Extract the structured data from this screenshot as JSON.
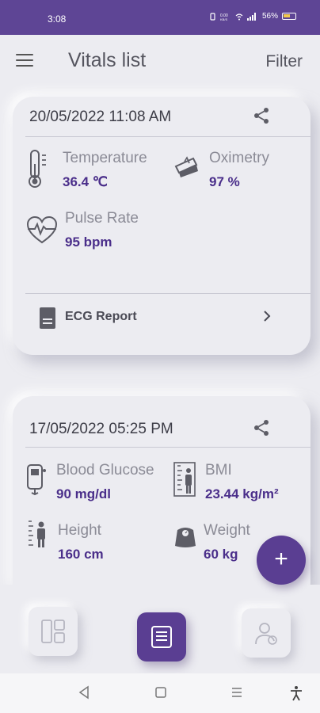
{
  "status_bar": {
    "time": "3:08",
    "battery": "56%",
    "indicators": [
      "vibrate-icon",
      "data-speed-icon",
      "wifi-icon",
      "signal-icon",
      "battery-icon"
    ]
  },
  "header": {
    "title": "Vitals list",
    "filter_label": "Filter",
    "menu_icon": "hamburger-icon"
  },
  "records": [
    {
      "date": "20/05/2022 11:08 AM",
      "vitals": [
        {
          "label": "Temperature",
          "value": "36.4 ℃",
          "icon": "thermometer-icon"
        },
        {
          "label": "Oximetry",
          "value": "97 %",
          "icon": "oximeter-icon"
        },
        {
          "label": "Pulse Rate",
          "value": "95 bpm",
          "icon": "heart-pulse-icon"
        }
      ],
      "report": {
        "label": "ECG Report",
        "icon": "document-icon"
      }
    },
    {
      "date": "17/05/2022 05:25 PM",
      "vitals": [
        {
          "label": "Blood Glucose",
          "value": "90 mg/dl",
          "icon": "glucometer-icon"
        },
        {
          "label": "BMI",
          "value": "23.44 kg/m²",
          "icon": "bmi-icon"
        },
        {
          "label": "Height",
          "value": "160 cm",
          "icon": "height-icon"
        },
        {
          "label": "Weight",
          "value": "60 kg",
          "icon": "weight-scale-icon"
        }
      ]
    }
  ],
  "fab": {
    "label": "+"
  },
  "bottom_nav": [
    {
      "icon": "dashboard-icon",
      "active": false
    },
    {
      "icon": "list-icon",
      "active": true
    },
    {
      "icon": "profile-icon",
      "active": false
    }
  ],
  "colors": {
    "accent": "#5a3e92",
    "value_text": "#4a2e8a",
    "background": "#ececf1",
    "status_bar": "#5e4595"
  }
}
